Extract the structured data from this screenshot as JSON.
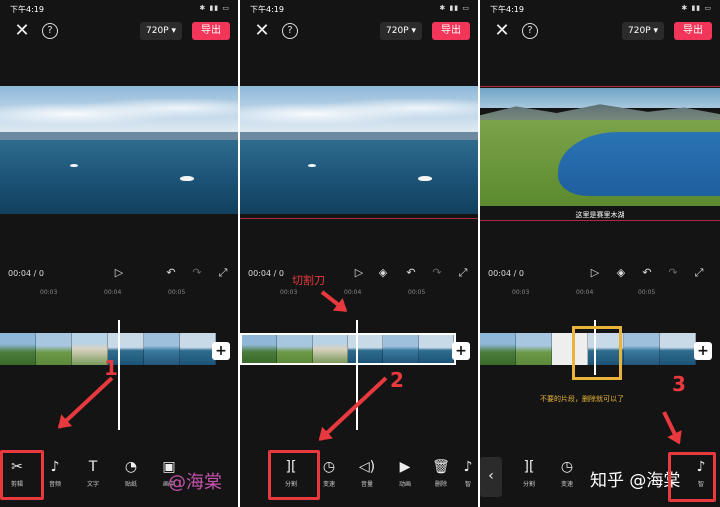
{
  "status": {
    "time": "下午4:19"
  },
  "header": {
    "resolution": "720P ▾",
    "export": "导出"
  },
  "playback": {
    "time": "00:04 / 0"
  },
  "ruler": [
    "00:03",
    "00:04",
    "00:05"
  ],
  "video_subtitle": "这里是赛里木湖",
  "toolbar1": [
    "剪辑",
    "音频",
    "文字",
    "贴纸",
    "画中"
  ],
  "toolbar2": [
    "分割",
    "变速",
    "音量",
    "动画",
    "删除",
    "智"
  ],
  "toolbar3": [
    "分割",
    "变速",
    "智"
  ],
  "annotations": {
    "step1": "1",
    "step2": "2",
    "step3": "3",
    "cutter": "切割刀",
    "unwanted": "不要的片段，删除就可以了",
    "watermark": "@海棠",
    "zhihu": "知乎 @海棠"
  },
  "colors": {
    "accent": "#f2365a",
    "annotation_red": "#e8393e",
    "annotation_yellow": "#e8b53a"
  }
}
